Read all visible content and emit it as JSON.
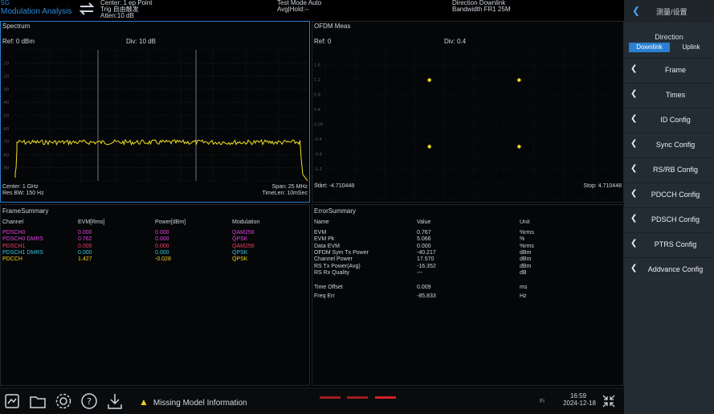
{
  "header": {
    "app_line1": "5G",
    "app_line2": "Modulation Analysis",
    "trig_line1": "Center: 1 ep Point",
    "trig_line2": "Trig 自由触发",
    "trig_line3": "Atten:10 dB",
    "mid_line1": "Test Mode Auto",
    "mid_line2": "Avg|Hold:--",
    "right_line1": "Direction Downlink",
    "right_line2": "Bandwidth FR1 25M"
  },
  "spectrum": {
    "title": "Spectrum",
    "ref": "Ref: 0 dBm",
    "div": "Div: 10 dB",
    "y_ticks": [
      "-10",
      "-20",
      "-30",
      "-40",
      "-50",
      "-60",
      "-70",
      "-80",
      "-90"
    ],
    "foot_left1": "Center: 1 GHz",
    "foot_left2": "Res BW: 150 Hz",
    "foot_right1": "Span: 25 MHz",
    "foot_right2": "TimeLen: 10mSec"
  },
  "ofdm": {
    "title": "OFDM Meas",
    "ref": "Ref: 0",
    "div": "Div: 0.4",
    "y_ticks": [
      "1.6",
      "1.2",
      "0.8",
      "0.4",
      "0.00",
      "-0.4",
      "-0.8",
      "-1.2",
      "-1.6"
    ],
    "start": "Start: -4.710448",
    "stop": "Stop: 4.710448"
  },
  "frame_summary": {
    "title": "FrameSummary",
    "headers": [
      "Channel",
      "EVM[Rms]",
      "Power[dBm]",
      "Modulation"
    ],
    "rows": [
      {
        "channel": "PDSCH0",
        "evm": "0.000",
        "power": "0.000",
        "mod": "QAM256",
        "color": "#e23fe0"
      },
      {
        "channel": "PDSCH0 DMRS",
        "evm": "0.762",
        "power": "0.000",
        "mod": "QPSK",
        "color": "#e23fe0"
      },
      {
        "channel": "PDSCH1",
        "evm": "0.000",
        "power": "0.000",
        "mod": "QAM256",
        "color": "#f04060"
      },
      {
        "channel": "PDSCH1 DMRS",
        "evm": "0.000",
        "power": "0.000",
        "mod": "QPSK",
        "color": "#30c8e0"
      },
      {
        "channel": "PDCCH",
        "evm": "1.427",
        "power": "-0.028",
        "mod": "QPSK",
        "color": "#f0d020"
      }
    ]
  },
  "error_summary": {
    "title": "ErrorSummary",
    "headers": [
      "Name",
      "Value",
      "Unit"
    ],
    "rows": [
      {
        "name": "EVM",
        "value": "0.767",
        "unit": "%rms"
      },
      {
        "name": "EVM Pk",
        "value": "5.066",
        "unit": "%"
      },
      {
        "name": "Data EVM",
        "value": "0.000",
        "unit": "%rms"
      },
      {
        "name": "OFDM Sym Tx Power",
        "value": "-40.217",
        "unit": "dBm"
      },
      {
        "name": "Channel Power",
        "value": "17.570",
        "unit": "dBm"
      },
      {
        "name": "RS Tx Power(Avg)",
        "value": "-16.352",
        "unit": "dBm"
      },
      {
        "name": "RS Rx Quality",
        "value": "---",
        "unit": "dB"
      },
      {
        "name": "",
        "value": "",
        "unit": ""
      },
      {
        "name": "Time Offset",
        "value": "0.009",
        "unit": "ms"
      },
      {
        "name": "Freq Err",
        "value": "-85.833",
        "unit": "Hz"
      }
    ]
  },
  "taskbar": {
    "warning": "Missing Model Information",
    "fi": "Fi",
    "time": "16:59",
    "date": "2024-12-18"
  },
  "sidebar": {
    "title": "测量/设置",
    "direction_label": "Direction",
    "downlink": "Downlink",
    "uplink": "Uplink",
    "items": [
      "Frame",
      "Times",
      "ID Config",
      "Sync Config",
      "RS/RB Config",
      "PDCCH Config",
      "PDSCH Config",
      "PTRS Config",
      "Addvance Config"
    ]
  },
  "colors": {
    "accent": "#2a7fd0",
    "trace": "#f0e020",
    "warning": "#f0d020",
    "taskbar_red": "#d4222a"
  }
}
